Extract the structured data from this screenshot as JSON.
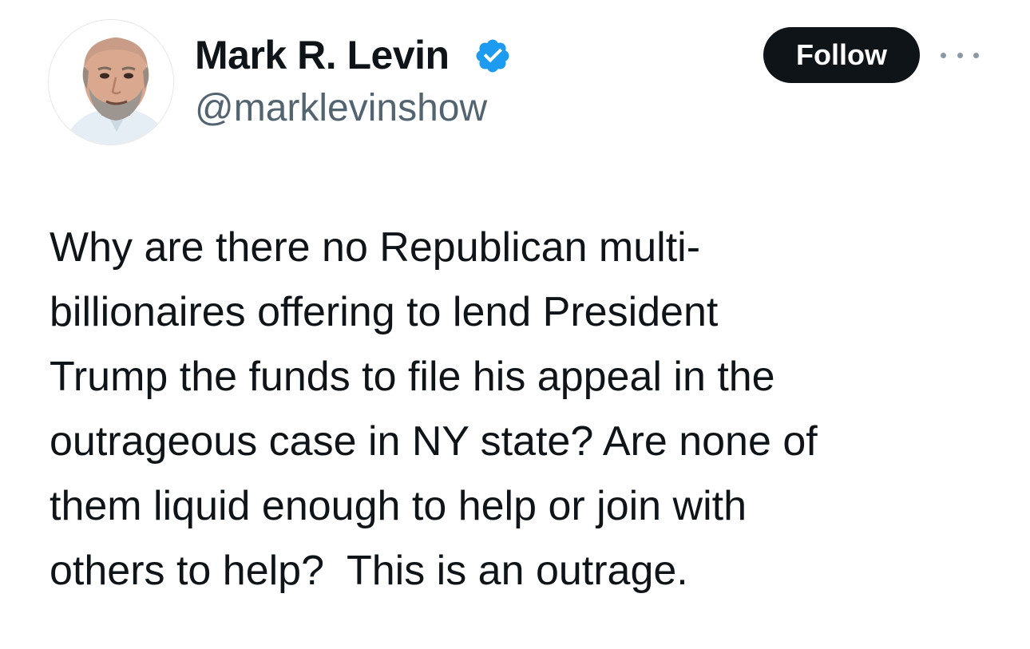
{
  "author": {
    "display_name": "Mark R. Levin",
    "handle": "@marklevinshow",
    "verified": true,
    "verified_badge_color": "#1d9bf0"
  },
  "actions": {
    "follow_label": "Follow",
    "more_icon": "more-dots-icon"
  },
  "tweet": {
    "lines": [
      "Why are there no Republican multi-",
      "billionaires offering to lend President",
      "Trump the funds to file his appeal in the",
      "outrageous case in NY state? Are none of",
      "them liquid enough to help or join with",
      "others to help?  This is an outrage."
    ]
  },
  "colors": {
    "text": "#0f1419",
    "secondary_text": "#536471",
    "follow_button_bg": "#0f1419",
    "follow_button_text": "#ffffff"
  }
}
